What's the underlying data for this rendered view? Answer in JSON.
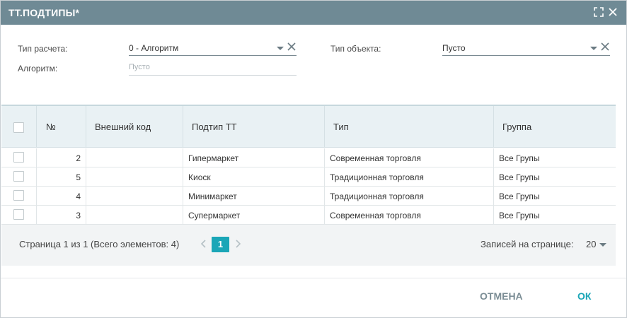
{
  "window": {
    "title": "ТТ.ПОДТИПЫ*",
    "maximize_icon": "maximize-icon",
    "close_icon": "close-icon"
  },
  "form": {
    "calc_type": {
      "label": "Тип расчета:",
      "value": "0 - Алгоритм"
    },
    "algorithm": {
      "label": "Алгоритм:",
      "placeholder": "Пусто"
    },
    "object_type": {
      "label": "Тип объекта:",
      "value": "Пусто"
    }
  },
  "grid": {
    "columns": [
      "№",
      "Внешний код",
      "Подтип ТТ",
      "Тип",
      "Группа"
    ],
    "rows": [
      {
        "num": "2",
        "ext_code": "",
        "subtype": "Гипермаркет",
        "type": "Современная торговля",
        "group": "Все Групы"
      },
      {
        "num": "5",
        "ext_code": "",
        "subtype": "Киоск",
        "type": "Традиционная торговля",
        "group": "Все Групы"
      },
      {
        "num": "4",
        "ext_code": "",
        "subtype": "Минимаркет",
        "type": "Традиционная торговля",
        "group": "Все Групы"
      },
      {
        "num": "3",
        "ext_code": "",
        "subtype": "Супермаркет",
        "type": "Современная торговля",
        "group": "Все Групы"
      }
    ]
  },
  "pager": {
    "info": "Страница 1 из 1 (Всего элементов: 4)",
    "current_page": "1",
    "rows_per_page_label": "Записей на странице:",
    "rows_per_page_value": "20"
  },
  "footer": {
    "cancel_label": "ОТМЕНА",
    "ok_label": "ОК"
  },
  "colors": {
    "titlebar": "#6f8a95",
    "accent": "#1aa6b7",
    "grid_header": "#e9f1f4",
    "pager_bg": "#f2f4f5"
  }
}
